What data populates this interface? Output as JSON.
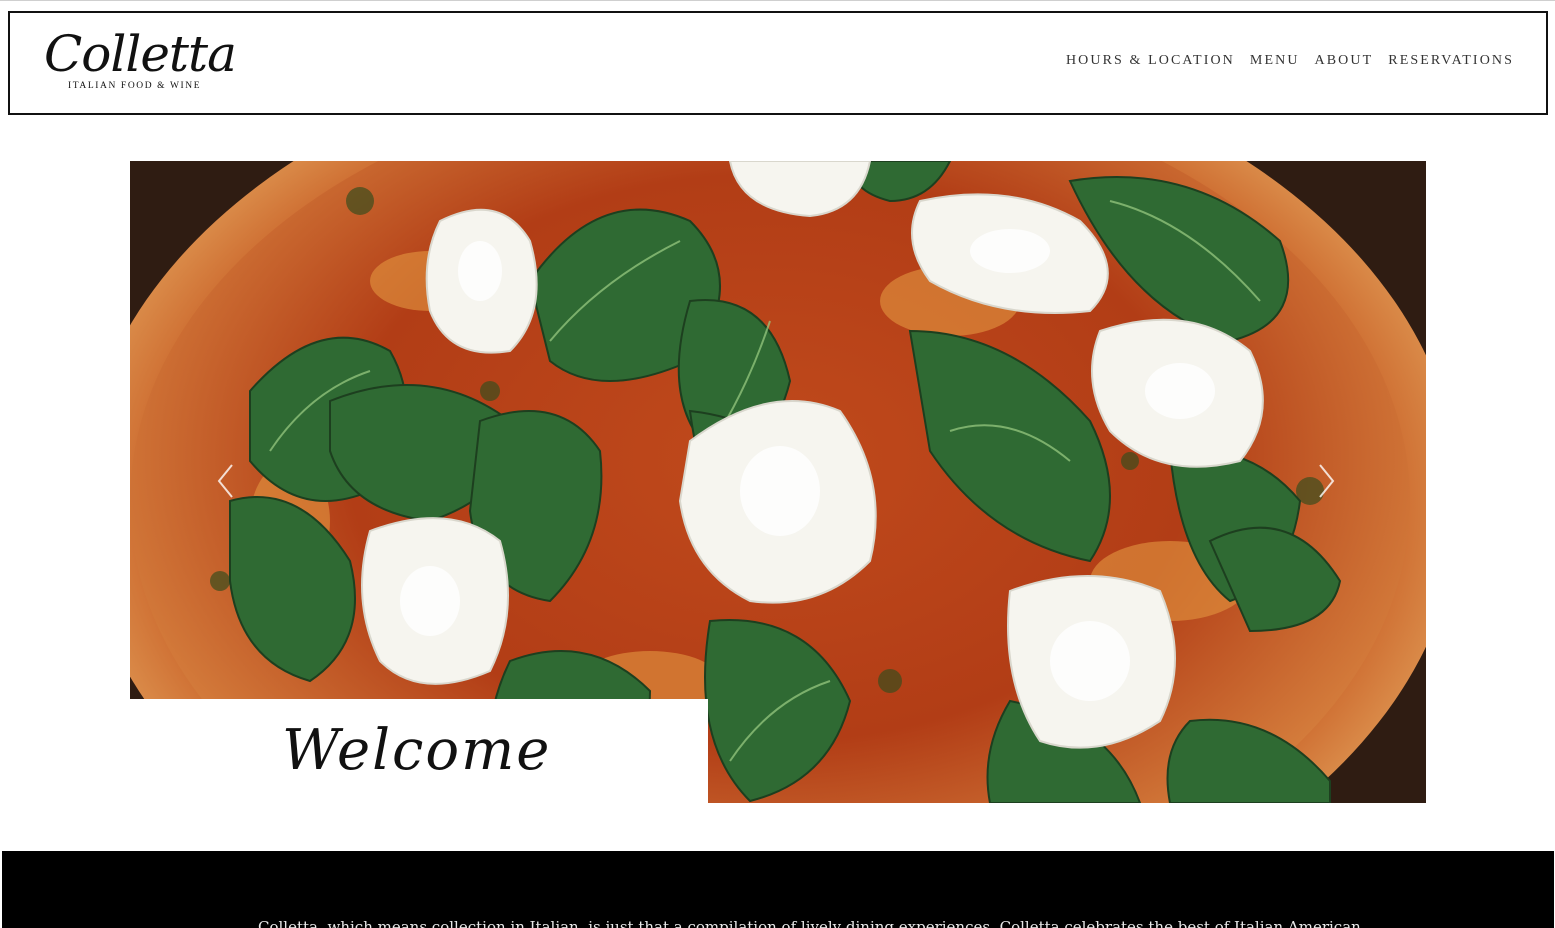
{
  "brand": {
    "name": "Colletta",
    "tagline": "ITALIAN FOOD & WINE"
  },
  "nav": {
    "items": [
      {
        "label": "HOURS & LOCATION"
      },
      {
        "label": "MENU"
      },
      {
        "label": "ABOUT"
      },
      {
        "label": "RESERVATIONS"
      }
    ]
  },
  "hero": {
    "image": "pizza-with-burrata-and-greens",
    "heading": "Welcome",
    "prev_icon": "chevron-left-icon",
    "next_icon": "chevron-right-icon"
  },
  "intro": {
    "text": "Colletta, which means collection in Italian, is just that a compilation of lively dining experiences. Colletta celebrates the best of Italian American"
  },
  "colors": {
    "header_border": "#111111",
    "band": "#000000",
    "nav_text": "#333333"
  }
}
